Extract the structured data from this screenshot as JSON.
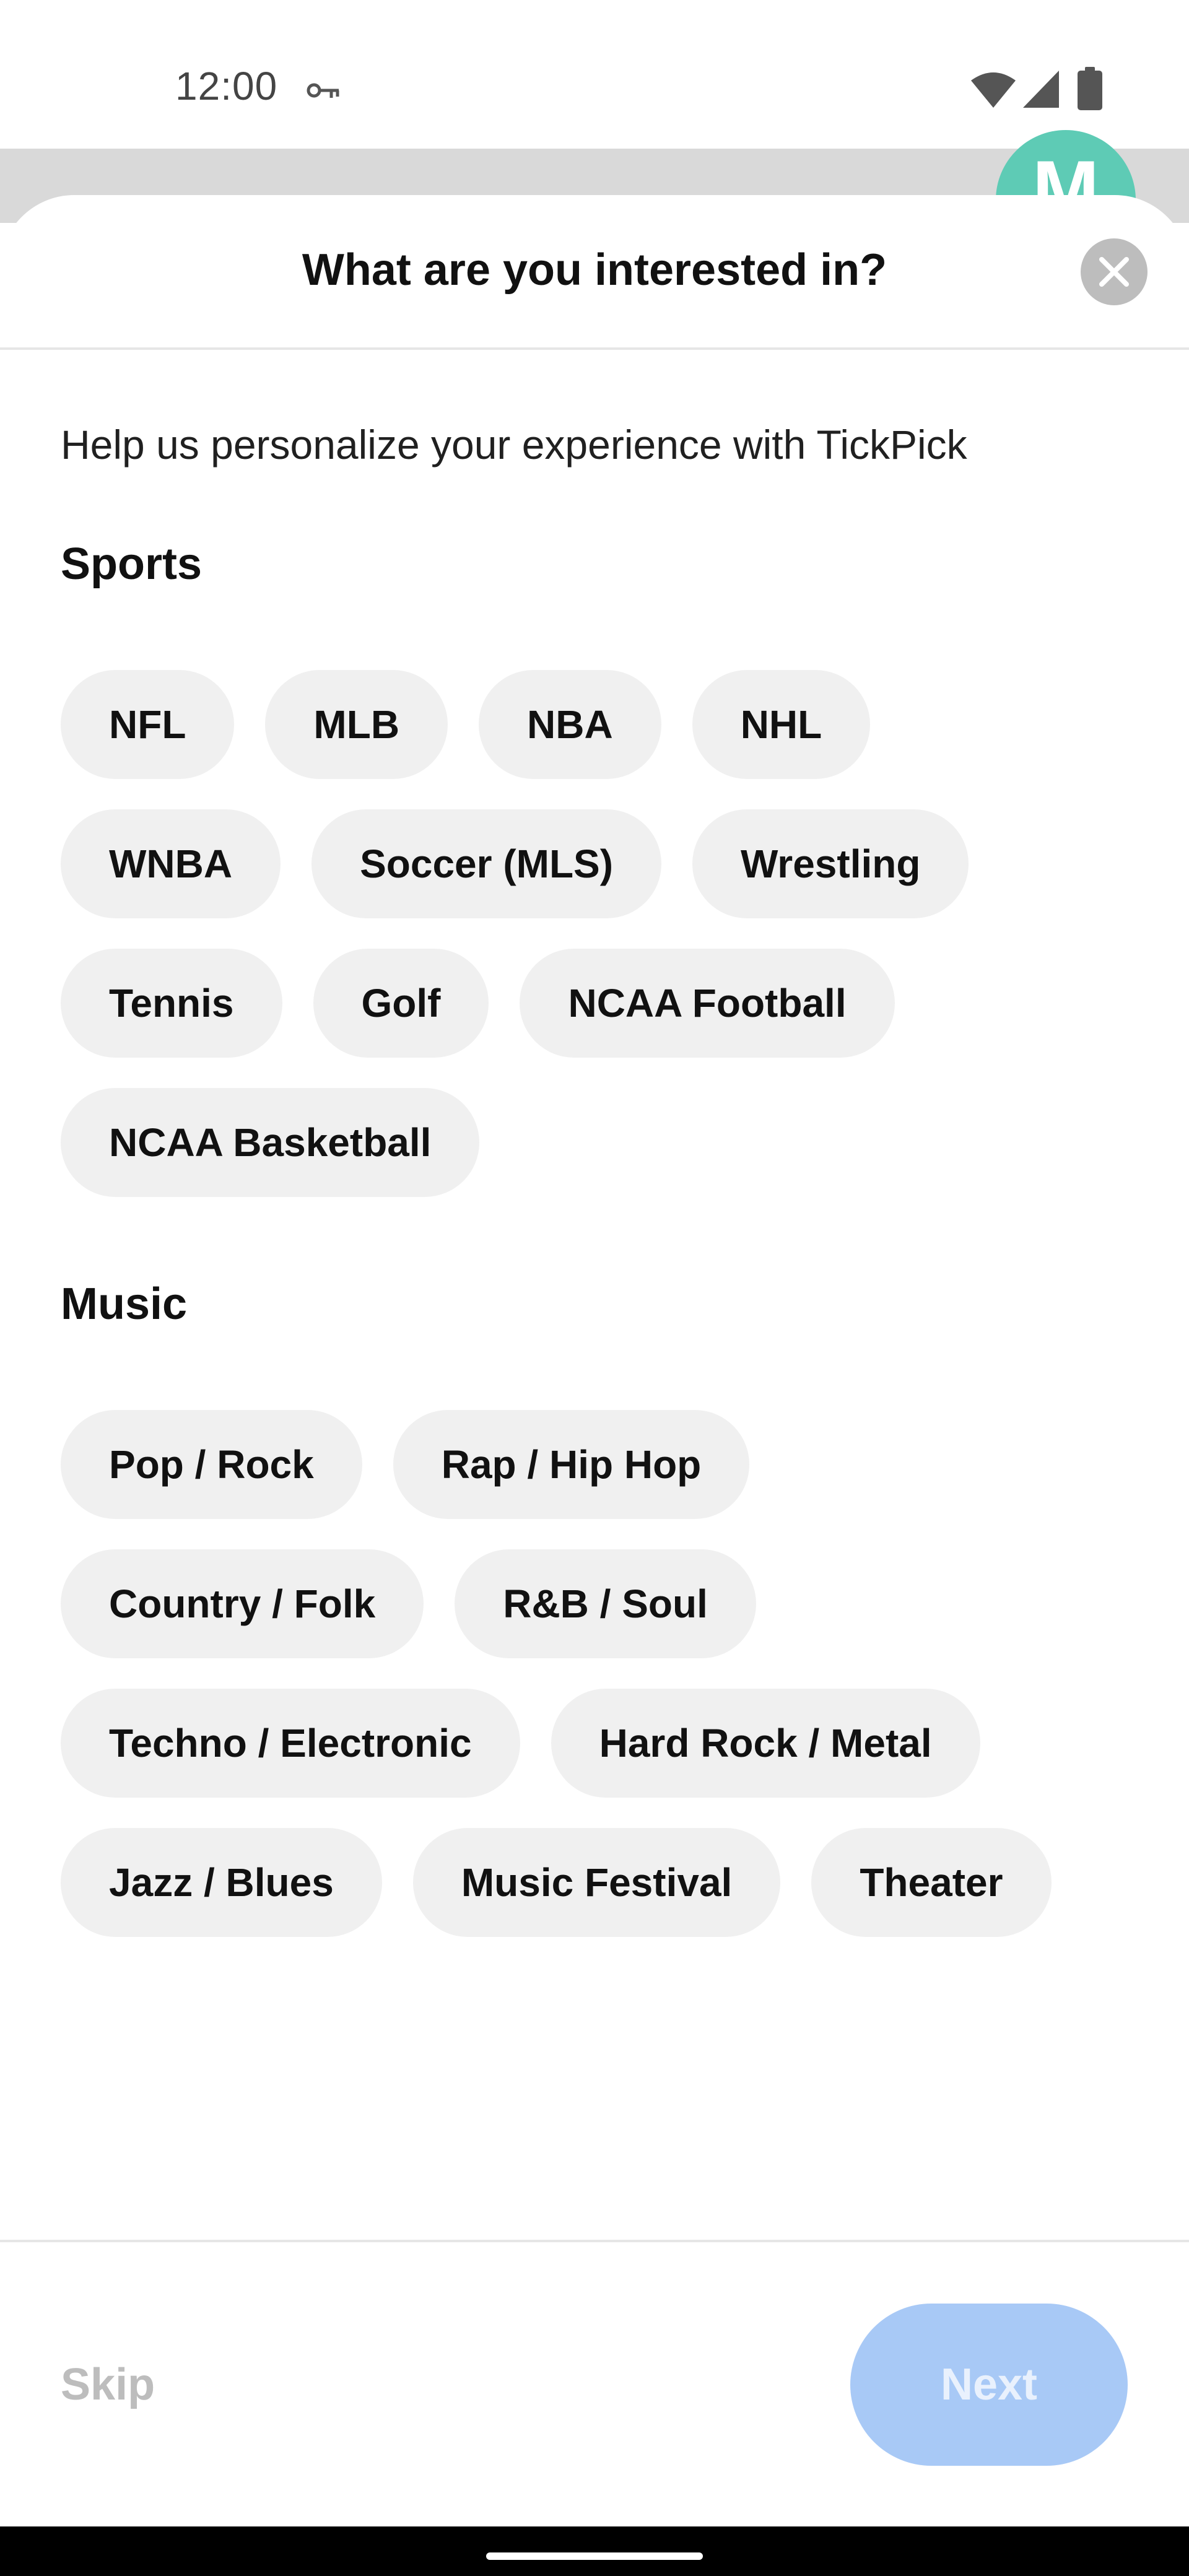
{
  "status_bar": {
    "time": "12:00",
    "icons": [
      "key-icon",
      "wifi-icon",
      "signal-icon",
      "battery-icon"
    ]
  },
  "background": {
    "avatar_letter": "M",
    "avatar_color": "#5ecbb5"
  },
  "sheet": {
    "title": "What are you interested in?",
    "close_icon": "close-icon",
    "subtitle": "Help us personalize your experience with TickPick",
    "sections": [
      {
        "title": "Sports",
        "chips": [
          "NFL",
          "MLB",
          "NBA",
          "NHL",
          "WNBA",
          "Soccer (MLS)",
          "Wrestling",
          "Tennis",
          "Golf",
          "NCAA Football",
          "NCAA Basketball"
        ]
      },
      {
        "title": "Music",
        "chips": [
          "Pop / Rock",
          "Rap / Hip Hop",
          "Country / Folk",
          "R&B / Soul",
          "Techno / Electronic",
          "Hard Rock / Metal",
          "Jazz / Blues",
          "Music Festival",
          "Theater"
        ]
      }
    ]
  },
  "footer": {
    "skip_label": "Skip",
    "next_label": "Next",
    "next_color": "#a8c9f6"
  }
}
